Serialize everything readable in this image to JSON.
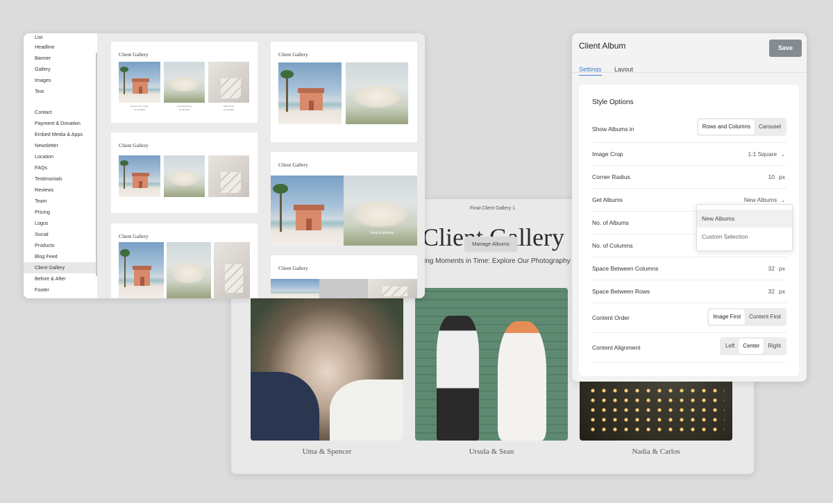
{
  "left_window": {
    "nav_items_top": [
      "List",
      "Headline",
      "Banner",
      "Gallery",
      "Images",
      "Text"
    ],
    "nav_items_bottom": [
      "Contact",
      "Payment & Donation",
      "Embed Media & Apps",
      "Newsletter",
      "Location",
      "FAQs",
      "Testimonials",
      "Reviews",
      "Team",
      "Pricing",
      "Logos",
      "Social",
      "Products",
      "Blog Feed",
      "Client Gallery",
      "Before & After",
      "Footer"
    ],
    "active_item": "Client Gallery",
    "card_title": "Client Gallery",
    "card_captions": [
      "Explore Your Client",
      "Keep Exploring",
      "Take Action"
    ],
    "card_dates": [
      "12.18.2024",
      "12.18.2024",
      "12.18.2024"
    ],
    "overlay_caption": "Keep Exploring"
  },
  "preview": {
    "topbar_title": "Final Client Gallery 1",
    "title": "Client Gallery",
    "subtitle": "ing Moments in Time: Explore Our Photography Portfo",
    "manage_button": "Manage Albums",
    "albums": [
      {
        "name": "Uma & Spencer"
      },
      {
        "name": "Ursula & Sean"
      },
      {
        "name": "Nadia & Carlos"
      }
    ]
  },
  "settings": {
    "title": "Client Album",
    "save_label": "Save",
    "tabs": [
      "Settings",
      "Layout"
    ],
    "active_tab": "Settings",
    "section_title": "Style Options",
    "show_albums_label": "Show Albums in",
    "show_albums_options": [
      "Rows and Columns",
      "Carousel"
    ],
    "show_albums_selected": "Rows and Columns",
    "image_crop_label": "Image Crop",
    "image_crop_value": "1:1 Square",
    "corner_radius_label": "Corner Radius",
    "corner_radius_value": "10",
    "get_albums_label": "Get Albums",
    "get_albums_value": "New Albums",
    "get_albums_options": [
      "New Albums",
      "Custom Selection"
    ],
    "num_albums_label": "No. of Albums",
    "num_columns_label": "No. of Columns",
    "space_columns_label": "Space Between Columns",
    "space_columns_value": "32",
    "space_rows_label": "Space Between Rows",
    "space_rows_value": "32",
    "unit_px": "px",
    "content_order_label": "Content Order",
    "content_order_options": [
      "Image First",
      "Content First"
    ],
    "content_order_selected": "Image First",
    "content_alignment_label": "Content Alignment",
    "content_alignment_options": [
      "Left",
      "Center",
      "Right"
    ],
    "content_alignment_selected": "Center"
  },
  "colors": {
    "accent": "#3b7fd4",
    "save_button": "#858b92",
    "background": "#dcdcdc"
  }
}
